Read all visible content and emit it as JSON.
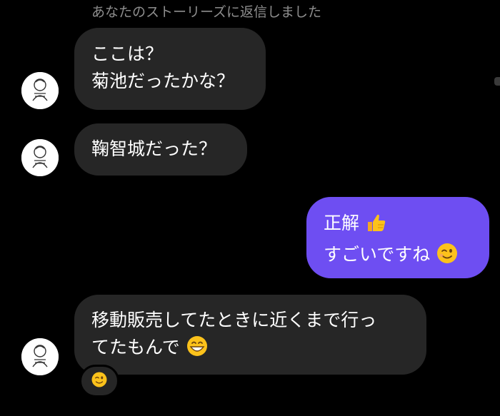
{
  "thread": {
    "context_label": "あなたのストーリーズに返信しました",
    "messages": [
      {
        "lines": [
          "ここは？",
          "菊池だったかな？"
        ]
      },
      {
        "lines": [
          "鞠智城だった？"
        ]
      },
      {
        "lines": [
          "正解",
          "すごいですね"
        ],
        "emojis": [
          "thumbs-up",
          "winking-face"
        ]
      },
      {
        "lines": [
          "移動販売してたときに近くまで行っ",
          "てたもんで"
        ],
        "emojis": [
          "grinning-face"
        ],
        "reaction": "winking-face"
      }
    ]
  },
  "colors": {
    "background": "#000000",
    "received_bubble": "#262626",
    "sent_bubble": "#6e4ef2",
    "context_text": "#8e8e8e"
  }
}
